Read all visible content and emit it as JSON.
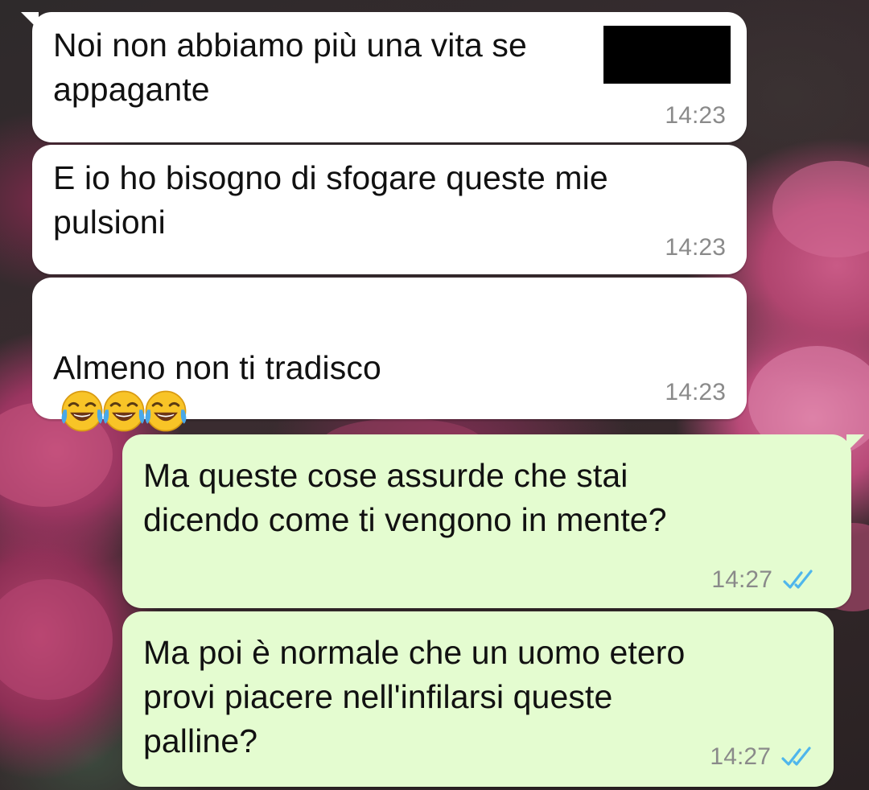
{
  "chat": {
    "messages": [
      {
        "direction": "incoming",
        "text": "Noi non abbiamo più una vita se\nappagante",
        "time": "14:23",
        "redacted": true
      },
      {
        "direction": "incoming",
        "text": "E io ho bisogno di sfogare queste mie\npulsioni",
        "time": "14:23"
      },
      {
        "direction": "incoming",
        "text": "Almeno non ti tradisco",
        "emoji": [
          "face-with-tears-of-joy-icon",
          "face-with-tears-of-joy-icon",
          "face-with-tears-of-joy-icon"
        ],
        "time": "14:23"
      },
      {
        "direction": "outgoing",
        "text": "Ma queste cose assurde che stai\ndicendo come ti vengono in mente?",
        "time": "14:27",
        "status": "read"
      },
      {
        "direction": "outgoing",
        "text": "Ma poi è normale che un uomo etero\nprovi piacere nell'infilarsi queste\npalline?",
        "time": "14:27",
        "status": "read"
      }
    ]
  },
  "colors": {
    "incoming_bubble": "#ffffff",
    "outgoing_bubble": "#e4fcd0",
    "read_ticks": "#4fb6ec",
    "timestamp": "#8a8a8a"
  }
}
